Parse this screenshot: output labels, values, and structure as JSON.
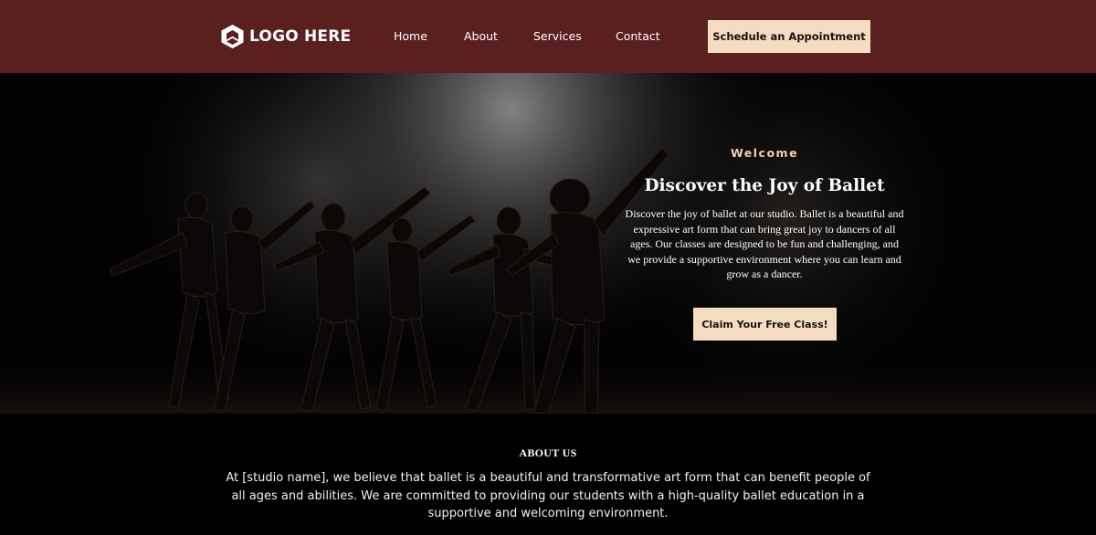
{
  "brand": {
    "logo_text": "LOGO HERE"
  },
  "nav": {
    "items": [
      {
        "label": "Home"
      },
      {
        "label": "About"
      },
      {
        "label": "Services"
      },
      {
        "label": "Contact"
      }
    ],
    "cta_label": "Schedule an Appointment"
  },
  "hero": {
    "eyebrow": "Welcome",
    "title": "Discover the Joy of Ballet",
    "description": "Discover the joy of ballet at our studio. Ballet is a beautiful and expressive art form that can bring great joy to dancers of all ages. Our classes are designed to be fun and challenging, and we provide a supportive environment where you can learn and grow as a dancer.",
    "cta_label": "Claim Your Free Class!"
  },
  "about": {
    "heading": "ABOUT US",
    "text": "At [studio name], we believe that ballet is a beautiful and transformative art form that can benefit people of all ages and abilities. We are committed to providing our students with a high-quality ballet education in a supportive and welcoming environment."
  },
  "colors": {
    "header_bg": "#5a2020",
    "accent_button": "#f4dcc0",
    "eyebrow": "#f0cfae",
    "page_bg": "#000000"
  }
}
